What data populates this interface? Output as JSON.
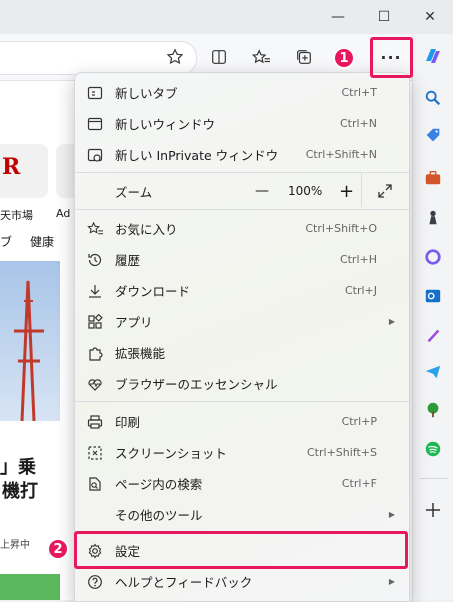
{
  "window": {
    "minimize_glyph": "—",
    "maximize_glyph": "☐",
    "close_glyph": "✕"
  },
  "toolbar": {
    "more_glyph": "···"
  },
  "badges": {
    "one": "1",
    "two": "2"
  },
  "background": {
    "logo_letter": "R",
    "tile1": "天市場",
    "tile2": "Ad",
    "nav1": "ブ",
    "nav2": "健康",
    "headline1": "」乗",
    "headline2": "機打",
    "caption": "上昇中"
  },
  "menu": {
    "items": [
      {
        "label": "新しいタブ",
        "shortcut": "Ctrl+T"
      },
      {
        "label": "新しいウィンドウ",
        "shortcut": "Ctrl+N"
      },
      {
        "label": "新しい InPrivate ウィンドウ",
        "shortcut": "Ctrl+Shift+N"
      },
      {
        "label": "お気に入り",
        "shortcut": "Ctrl+Shift+O"
      },
      {
        "label": "履歴",
        "shortcut": "Ctrl+H"
      },
      {
        "label": "ダウンロード",
        "shortcut": "Ctrl+J"
      },
      {
        "label": "アプリ",
        "shortcut": ""
      },
      {
        "label": "拡張機能",
        "shortcut": ""
      },
      {
        "label": "ブラウザーのエッセンシャル",
        "shortcut": ""
      },
      {
        "label": "印刷",
        "shortcut": "Ctrl+P"
      },
      {
        "label": "スクリーンショット",
        "shortcut": "Ctrl+Shift+S"
      },
      {
        "label": "ページ内の検索",
        "shortcut": "Ctrl+F"
      },
      {
        "label": "その他のツール",
        "shortcut": ""
      },
      {
        "label": "設定",
        "shortcut": ""
      },
      {
        "label": "ヘルプとフィードバック",
        "shortcut": ""
      }
    ],
    "zoom": {
      "label": "ズーム",
      "minus": "—",
      "value": "100%",
      "plus": "+"
    }
  },
  "colors": {
    "highlight": "#e8185f",
    "accent": "#0f6cbd"
  }
}
